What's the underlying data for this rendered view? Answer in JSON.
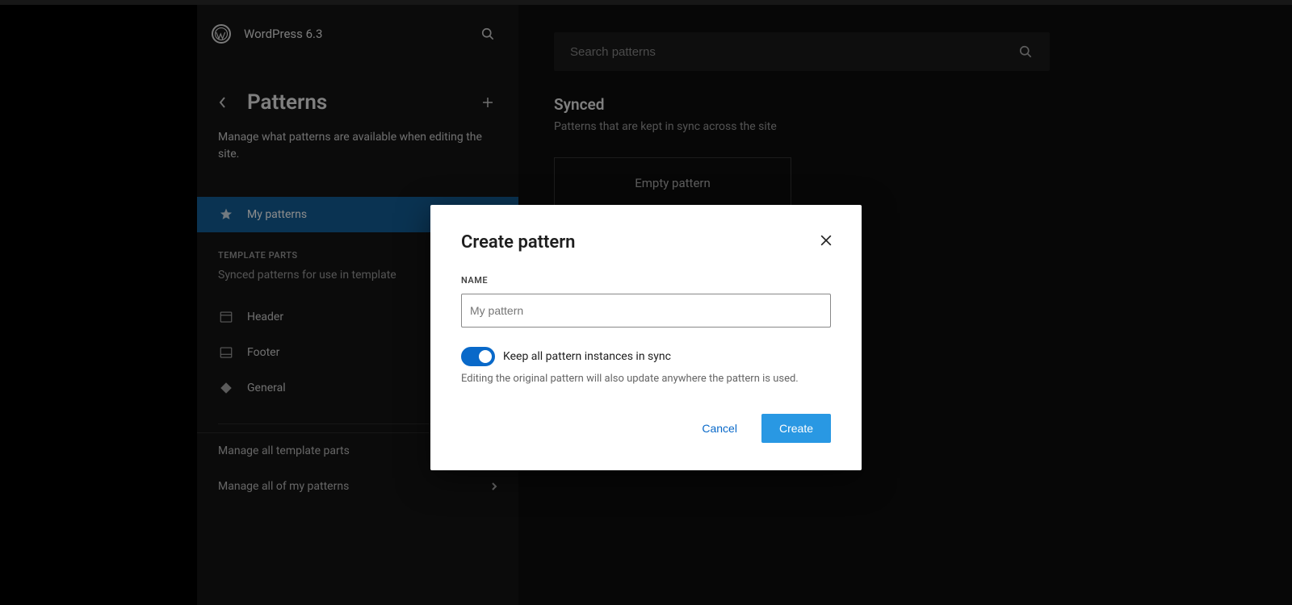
{
  "header": {
    "site_title": "WordPress 6.3"
  },
  "sidebar": {
    "title": "Patterns",
    "description": "Manage what patterns are available when editing the site.",
    "nav": {
      "my_patterns": "My patterns"
    },
    "template_parts": {
      "label": "TEMPLATE PARTS",
      "description": "Synced patterns for use in template",
      "items": [
        "Header",
        "Footer",
        "General"
      ]
    },
    "manage": {
      "template_parts": "Manage all template parts",
      "my_patterns": "Manage all of my patterns"
    }
  },
  "main": {
    "search_placeholder": "Search patterns",
    "heading": "Synced",
    "subtitle": "Patterns that are kept in sync across the site",
    "card": "Empty pattern"
  },
  "modal": {
    "title": "Create pattern",
    "name_label": "NAME",
    "name_placeholder": "My pattern",
    "sync_label": "Keep all pattern instances in sync",
    "sync_help": "Editing the original pattern will also update anywhere the pattern is used.",
    "cancel": "Cancel",
    "create": "Create"
  }
}
